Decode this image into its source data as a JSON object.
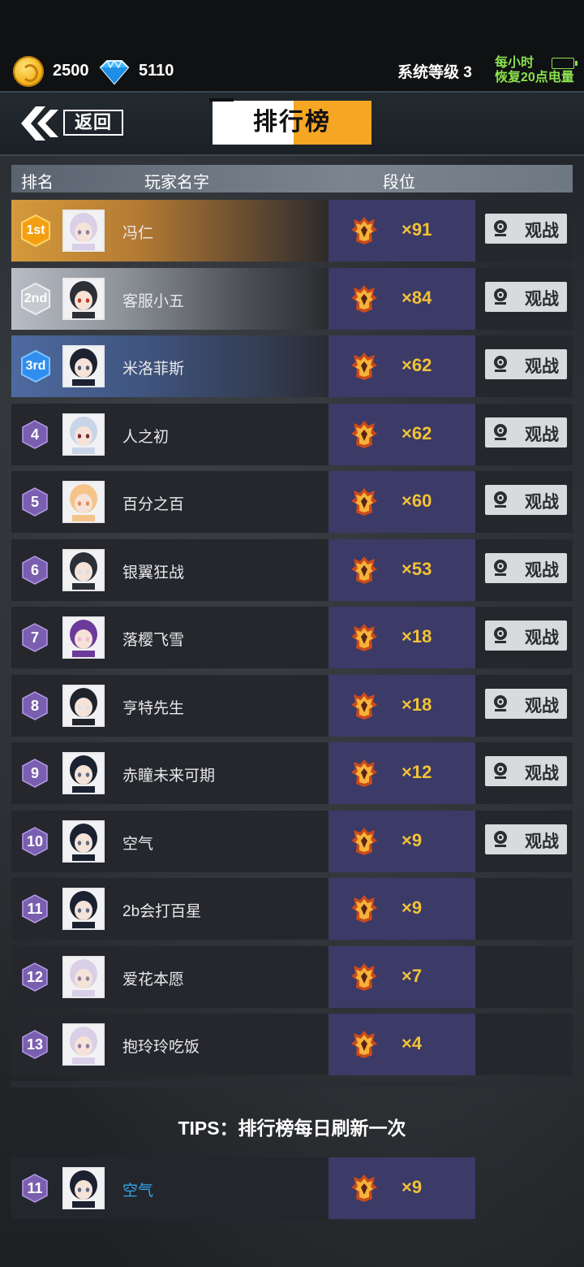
{
  "status": {
    "coins": "2500",
    "gems": "5110",
    "system_level": "系统等级 3",
    "recover_line1": "每小时",
    "recover_line2": "恢复20点电量"
  },
  "header": {
    "back_label": "返回",
    "title": "排行榜"
  },
  "columns": {
    "rank": "排名",
    "name": "玩家名字",
    "tier": "段位"
  },
  "watch_label": "观战",
  "rows": [
    {
      "rank": "1st",
      "name": "冯仁",
      "count": "×91",
      "watch": true
    },
    {
      "rank": "2nd",
      "name": "客服小五",
      "count": "×84",
      "watch": true
    },
    {
      "rank": "3rd",
      "name": "米洛菲斯",
      "count": "×62",
      "watch": true
    },
    {
      "rank": "4",
      "name": "人之初",
      "count": "×62",
      "watch": true
    },
    {
      "rank": "5",
      "name": "百分之百",
      "count": "×60",
      "watch": true
    },
    {
      "rank": "6",
      "name": "银翼狂战",
      "count": "×53",
      "watch": true
    },
    {
      "rank": "7",
      "name": "落樱飞雪",
      "count": "×18",
      "watch": true
    },
    {
      "rank": "8",
      "name": "亨特先生",
      "count": "×18",
      "watch": true
    },
    {
      "rank": "9",
      "name": "赤瞳未来可期",
      "count": "×12",
      "watch": true
    },
    {
      "rank": "10",
      "name": "空气",
      "count": "×9",
      "watch": true
    },
    {
      "rank": "11",
      "name": "2b会打百星",
      "count": "×9",
      "watch": false
    },
    {
      "rank": "12",
      "name": "爱花本愿",
      "count": "×7",
      "watch": false
    },
    {
      "rank": "13",
      "name": "抱玲玲吃饭",
      "count": "×4",
      "watch": false
    }
  ],
  "tips": "TIPS：排行榜每日刷新一次",
  "self_row": {
    "rank": "11",
    "name": "空气",
    "count": "×9"
  }
}
